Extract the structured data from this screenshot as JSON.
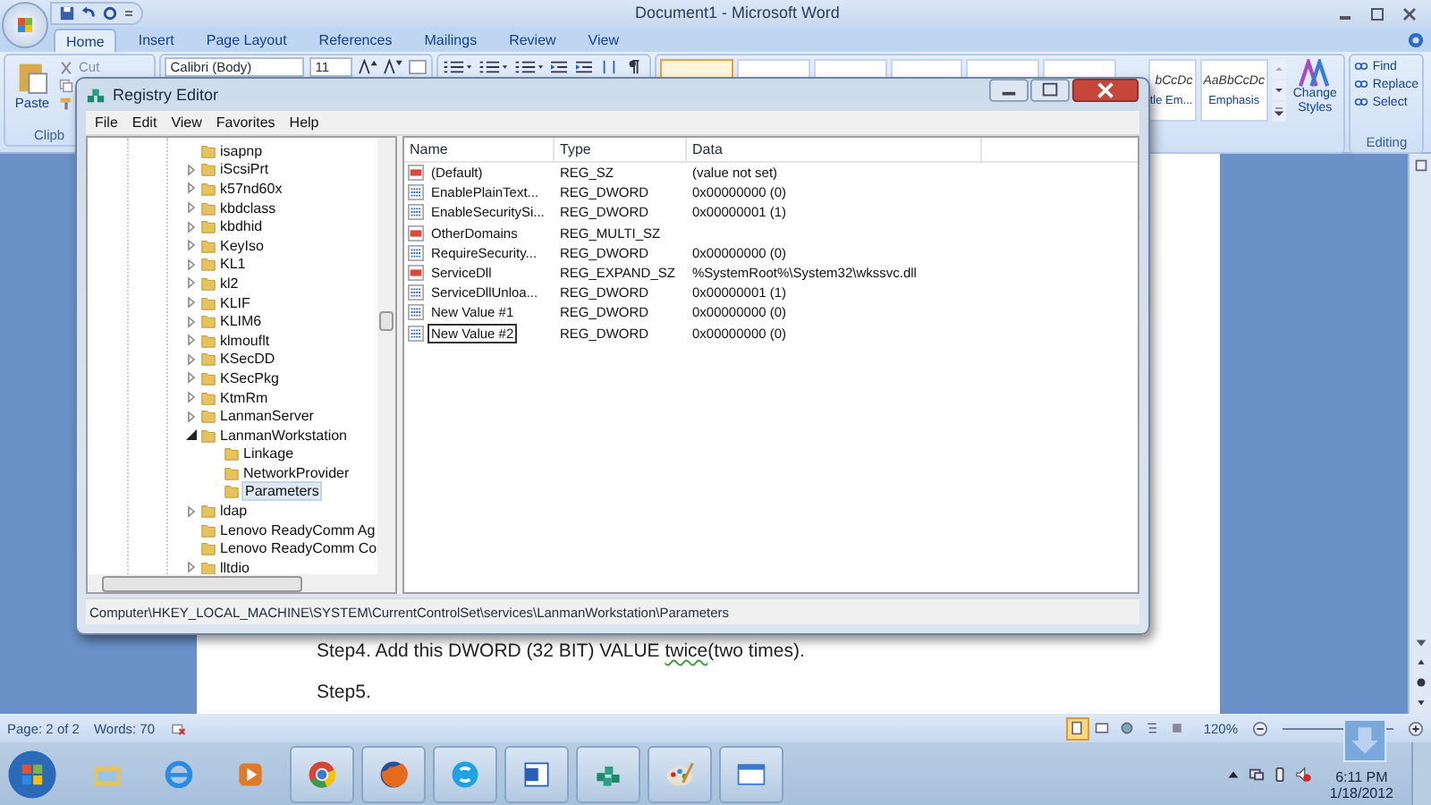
{
  "word": {
    "title": "Document1 - Microsoft Word",
    "tabs": [
      {
        "label": "Home",
        "selected": true
      },
      {
        "label": "Insert",
        "selected": false
      },
      {
        "label": "Page Layout",
        "selected": false
      },
      {
        "label": "References",
        "selected": false
      },
      {
        "label": "Mailings",
        "selected": false
      },
      {
        "label": "Review",
        "selected": false
      },
      {
        "label": "View",
        "selected": false
      }
    ],
    "clipboard": {
      "paste": "Paste",
      "cut": "Cut",
      "group_label": "Clipb"
    },
    "font": {
      "name": "Calibri (Body)",
      "size": "11"
    },
    "styles": [
      {
        "sample": "bCcDc",
        "label": "tle Em..."
      },
      {
        "sample": "AaBbCcDc",
        "label": "Emphasis"
      }
    ],
    "change_styles": "Change Styles",
    "editing": {
      "items": [
        "Find",
        "Replace",
        "Select"
      ],
      "group_label": "Editing"
    },
    "document": {
      "paragraphs": [
        [
          {
            "text": "Step4. Add this DWORD (32 BIT) VALUE ",
            "flagged": false
          },
          {
            "text": "twice",
            "flagged": true
          },
          {
            "text": "(two times).",
            "flagged": false
          }
        ],
        [
          {
            "text": "Step5.",
            "flagged": false
          }
        ]
      ]
    },
    "status_bar": {
      "page": "Page: 2 of 2",
      "words": "Words: 70",
      "zoom": "120%",
      "views": [
        {
          "kind": "print",
          "selected": true
        },
        {
          "kind": "reading",
          "selected": false
        },
        {
          "kind": "web",
          "selected": false
        },
        {
          "kind": "outline",
          "selected": false
        },
        {
          "kind": "draft",
          "selected": false
        }
      ]
    }
  },
  "registry": {
    "title": "Registry Editor",
    "menu": [
      "File",
      "Edit",
      "View",
      "Favorites",
      "Help"
    ],
    "tree": [
      {
        "label": "isapnp",
        "expandable": false,
        "selected": false
      },
      {
        "label": "iScsiPrt",
        "expandable": true,
        "expanded": false,
        "selected": false
      },
      {
        "label": "k57nd60x",
        "expandable": true,
        "expanded": false,
        "selected": false
      },
      {
        "label": "kbdclass",
        "expandable": true,
        "expanded": false,
        "selected": false
      },
      {
        "label": "kbdhid",
        "expandable": true,
        "expanded": false,
        "selected": false
      },
      {
        "label": "KeyIso",
        "expandable": true,
        "expanded": false,
        "selected": false
      },
      {
        "label": "KL1",
        "expandable": true,
        "expanded": false,
        "selected": false
      },
      {
        "label": "kl2",
        "expandable": true,
        "expanded": false,
        "selected": false
      },
      {
        "label": "KLIF",
        "expandable": true,
        "expanded": false,
        "selected": false
      },
      {
        "label": "KLIM6",
        "expandable": true,
        "expanded": false,
        "selected": false
      },
      {
        "label": "klmouflt",
        "expandable": true,
        "expanded": false,
        "selected": false
      },
      {
        "label": "KSecDD",
        "expandable": true,
        "expanded": false,
        "selected": false
      },
      {
        "label": "KSecPkg",
        "expandable": true,
        "expanded": false,
        "selected": false
      },
      {
        "label": "KtmRm",
        "expandable": true,
        "expanded": false,
        "selected": false
      },
      {
        "label": "LanmanServer",
        "expandable": true,
        "expanded": false,
        "selected": false
      },
      {
        "label": "LanmanWorkstation",
        "expandable": true,
        "expanded": true,
        "selected": false,
        "children": [
          {
            "label": "Linkage",
            "expandable": false,
            "selected": false
          },
          {
            "label": "NetworkProvider",
            "expandable": false,
            "selected": false
          },
          {
            "label": "Parameters",
            "expandable": false,
            "selected": true
          }
        ]
      },
      {
        "label": "ldap",
        "expandable": true,
        "expanded": false,
        "selected": false
      },
      {
        "label": "Lenovo ReadyComm Ag",
        "expandable": false,
        "selected": false
      },
      {
        "label": "Lenovo ReadyComm Co",
        "expandable": false,
        "selected": false
      },
      {
        "label": "lltdio",
        "expandable": true,
        "expanded": false,
        "selected": false
      }
    ],
    "columns": [
      "Name",
      "Type",
      "Data"
    ],
    "values": [
      {
        "kind": "string",
        "name": "(Default)",
        "type": "REG_SZ",
        "data": "(value not set)",
        "editing": false
      },
      {
        "kind": "binary",
        "name": "EnablePlainText...",
        "type": "REG_DWORD",
        "data": "0x00000000 (0)",
        "editing": false
      },
      {
        "kind": "binary",
        "name": "EnableSecuritySi...",
        "type": "REG_DWORD",
        "data": "0x00000001 (1)",
        "editing": false
      },
      {
        "kind": "string",
        "name": "OtherDomains",
        "type": "REG_MULTI_SZ",
        "editing": false
      },
      {
        "kind": "binary",
        "name": "RequireSecurity...",
        "type": "REG_DWORD",
        "data": "0x00000000 (0)",
        "editing": false
      },
      {
        "kind": "string",
        "name": "ServiceDll",
        "type": "REG_EXPAND_SZ",
        "data": "%SystemRoot%\\System32\\wkssvc.dll",
        "editing": false
      },
      {
        "kind": "binary",
        "name": "ServiceDllUnloa...",
        "type": "REG_DWORD",
        "data": "0x00000001 (1)",
        "editing": false
      },
      {
        "kind": "binary",
        "name": "New Value #1",
        "type": "REG_DWORD",
        "data": "0x00000000 (0)",
        "editing": false
      },
      {
        "kind": "binary",
        "name": "New Value #2",
        "type": "REG_DWORD",
        "data": "0x00000000 (0)",
        "editing": true
      }
    ],
    "path": "Computer\\HKEY_LOCAL_MACHINE\\SYSTEM\\CurrentControlSet\\services\\LanmanWorkstation\\Parameters"
  },
  "taskbar": {
    "apps": [
      {
        "kind": "folder",
        "running": false
      },
      {
        "kind": "browser-e",
        "running": false
      },
      {
        "kind": "media",
        "running": false
      },
      {
        "kind": "chrome",
        "running": true
      },
      {
        "kind": "firefox",
        "running": true
      },
      {
        "kind": "skype",
        "running": true
      },
      {
        "kind": "word",
        "running": true
      },
      {
        "kind": "cubes",
        "running": true
      },
      {
        "kind": "paint",
        "running": true
      },
      {
        "kind": "window",
        "running": true
      }
    ],
    "time": "6:11 PM",
    "date": "1/18/2012"
  }
}
